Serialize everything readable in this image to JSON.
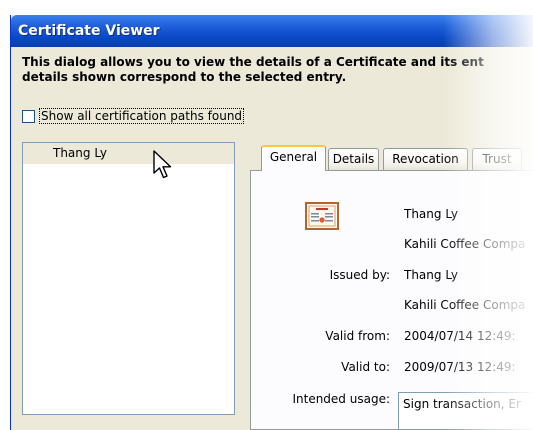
{
  "window": {
    "title": "Certificate Viewer"
  },
  "description": {
    "line1": "This dialog allows you to view the details of a Certificate and its ent",
    "line2": "details shown correspond to the selected entry."
  },
  "options": {
    "show_all_paths_label": "Show all certification paths found",
    "show_all_paths_checked": false
  },
  "tree": {
    "selected_item": "Thang Ly"
  },
  "tabs": [
    {
      "label": "General",
      "active": true
    },
    {
      "label": "Details",
      "active": false
    },
    {
      "label": "Revocation",
      "active": false
    },
    {
      "label": "Trust",
      "active": false
    }
  ],
  "general": {
    "icon": "certificate-icon",
    "subject_name": "Thang Ly",
    "subject_org": "Kahili Coffee Compa",
    "issued_by_label": "Issued by:",
    "issuer_name": "Thang Ly",
    "issuer_org": "Kahili Coffee Compa",
    "valid_from_label": "Valid from:",
    "valid_from": "2004/07/14 12:49:",
    "valid_to_label": "Valid to:",
    "valid_to": "2009/07/13 12:49:",
    "intended_usage_label": "Intended usage:",
    "intended_usage": "Sign transaction, Er"
  },
  "colors": {
    "titlebar": "#0a48c8",
    "dialog_bg": "#ece9d8",
    "active_tab_accent": "#ffc83c"
  }
}
